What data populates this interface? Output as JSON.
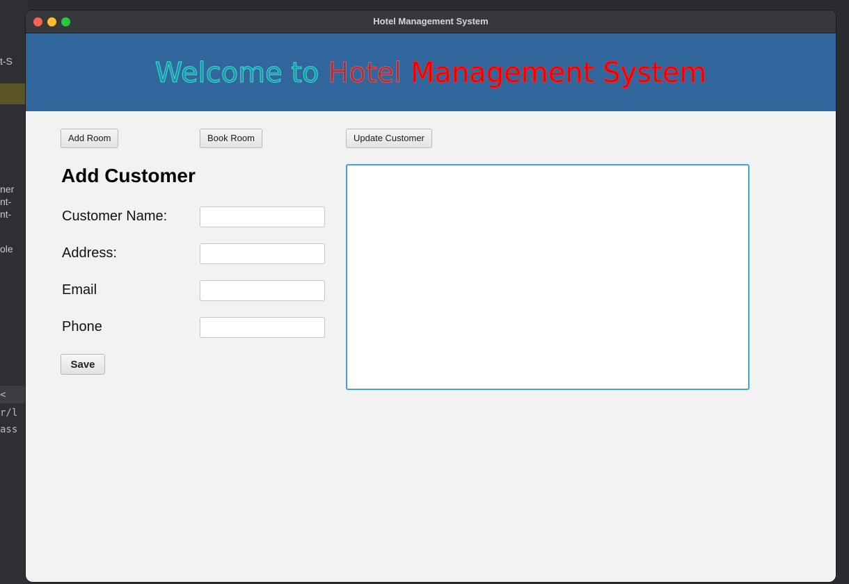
{
  "window": {
    "title": "Hotel Management System"
  },
  "background": {
    "fragments": [
      "t-S",
      "ner",
      "nt-",
      "nt-",
      "ole",
      "<",
      "r/l",
      "ass"
    ]
  },
  "header": {
    "welcome_part1": "Welcome to ",
    "welcome_part2": "Hotel ",
    "welcome_part3": "Management System",
    "bg_color": "#31679c"
  },
  "toolbar": {
    "add_room_label": "Add Room",
    "book_room_label": "Book Room",
    "update_customer_label": "Update Customer"
  },
  "form": {
    "heading": "Add Customer",
    "fields": [
      {
        "label": "Customer Name:",
        "value": ""
      },
      {
        "label": "Address:",
        "value": ""
      },
      {
        "label": "Email",
        "value": ""
      },
      {
        "label": "Phone",
        "value": ""
      }
    ],
    "save_label": "Save"
  },
  "output": {
    "text": ""
  },
  "colors": {
    "accent_focus": "#3fa3dc",
    "traffic_close": "#fe5f57",
    "traffic_min": "#febc2e",
    "traffic_max": "#28c840"
  }
}
